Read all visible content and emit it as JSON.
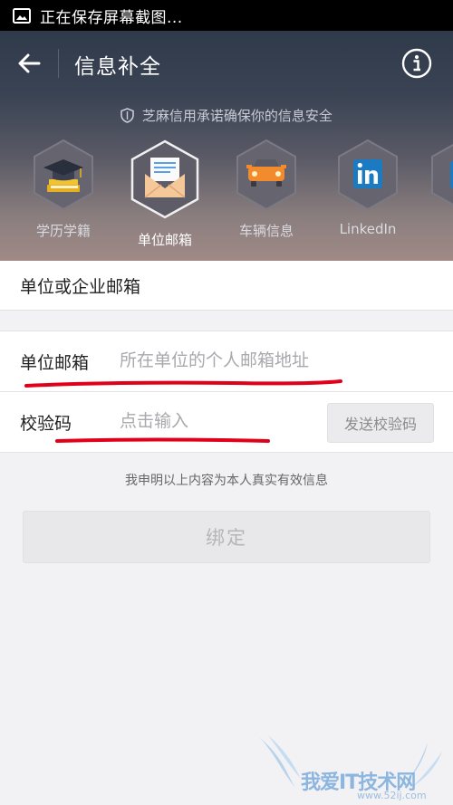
{
  "status_bar": {
    "text": "正在保存屏幕截图..."
  },
  "nav": {
    "title": "信息补全"
  },
  "promise": {
    "text": "芝麻信用承诺确保你的信息安全"
  },
  "categories": [
    {
      "label": "学历学籍",
      "icon": "graduation-cap-icon"
    },
    {
      "label": "单位邮箱",
      "icon": "envelope-icon"
    },
    {
      "label": "车辆信息",
      "icon": "car-icon"
    },
    {
      "label": "LinkedIn",
      "icon": "linkedin-icon"
    }
  ],
  "form": {
    "section_title": "单位或企业邮箱",
    "email_label": "单位邮箱",
    "email_placeholder": "所在单位的个人邮箱地址",
    "code_label": "校验码",
    "code_placeholder": "点击输入",
    "send_code": "发送校验码",
    "declaration": "我申明以上内容为本人真实有效信息",
    "bind": "绑定"
  },
  "watermark": {
    "text": "我爱IT技术网",
    "url": "www.52ij.com"
  },
  "colors": {
    "header_top": "#2f3a4b",
    "annotation_red": "#e0001a",
    "watermark_blue": "#6aa2d9"
  }
}
